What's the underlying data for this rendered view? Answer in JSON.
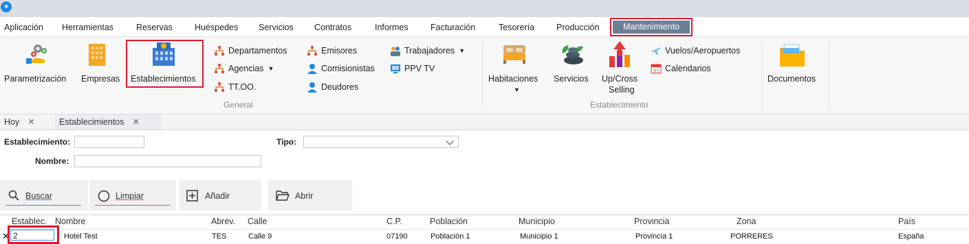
{
  "menu": [
    "Aplicación",
    "Herramientas",
    "Reservas",
    "Huéspedes",
    "Servicios",
    "Contratos",
    "Informes",
    "Facturación",
    "Tesorería",
    "Producción"
  ],
  "menu_active": "Mantenimiento",
  "ribbon": {
    "parametrizacion": "Parametrización",
    "empresas": "Empresas",
    "establecimientos": "Establecimientos",
    "departamentos": "Departamentos",
    "agencias": "Agencias",
    "ttoo": "TT.OO.",
    "emisores": "Emisores",
    "comisionistas": "Comisionistas",
    "deudores": "Deudores",
    "trabajadores": "Trabajadores",
    "ppvtv": "PPV TV",
    "group_general": "General",
    "habitaciones": "Habitaciones",
    "servicios": "Servicios",
    "upcross_1": "Up/Cross",
    "upcross_2": "Selling",
    "vuelos": "Vuelos/Aeropuertos",
    "calendarios": "Calendarios",
    "group_establecimiento": "Establecimiento",
    "documentos": "Documentos"
  },
  "tabs": [
    "Hoy",
    "Establecimientos"
  ],
  "filters": {
    "establecimiento_label": "Establecimiento:",
    "establecimiento_value": "",
    "tipo_label": "Tipo:",
    "tipo_value": "",
    "nombre_label": "Nombre:",
    "nombre_value": ""
  },
  "actions": {
    "buscar": "Buscar",
    "limpiar": "Limpiar",
    "anadir": "Añadir",
    "abrir": "Abrir"
  },
  "table": {
    "columns": [
      "Establec.",
      "Nombre",
      "Abrev.",
      "Calle",
      "C.P.",
      "Población",
      "Municipio",
      "Provincia",
      "Zona",
      "País"
    ],
    "rows": [
      [
        "2",
        "Hotel Test",
        "TES",
        "Calle 9",
        "07190",
        "Población 1",
        "Municipio 1",
        "Provincia 1",
        "PORRERES",
        "España"
      ]
    ]
  },
  "colors": {
    "highlight": "#e0182b",
    "active_menu": "#6d7f95",
    "accent_blue": "#1e88e5"
  }
}
